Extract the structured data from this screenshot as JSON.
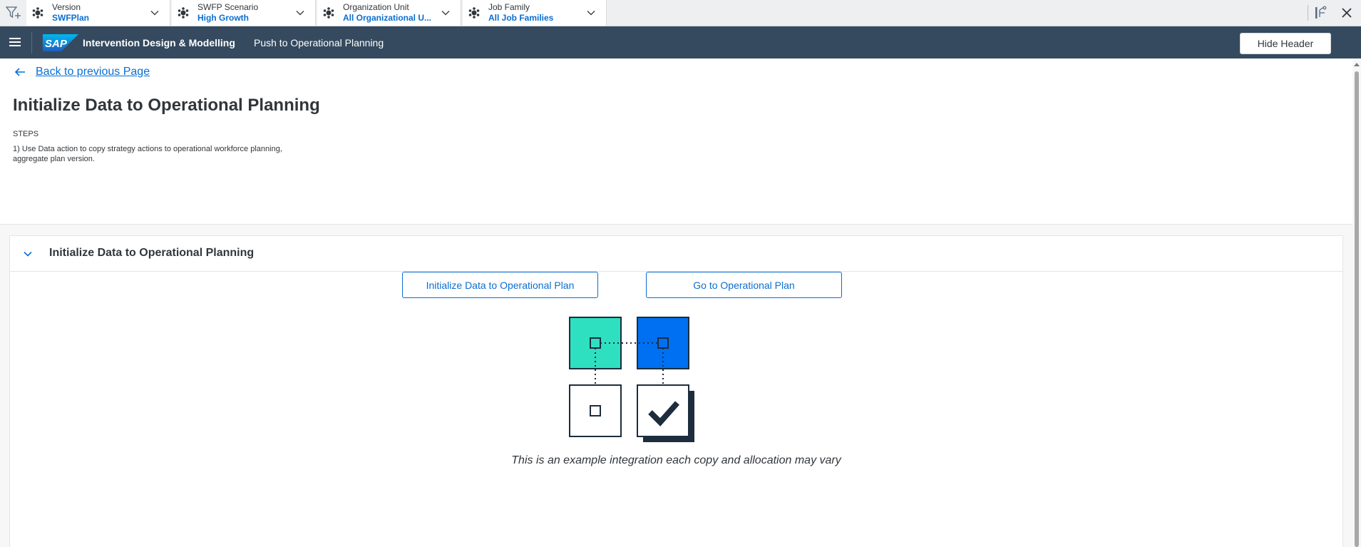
{
  "filter_bar": {
    "filters": [
      {
        "label": "Version",
        "value": "SWFPlan"
      },
      {
        "label": "SWFP Scenario",
        "value": "High Growth"
      },
      {
        "label": "Organization Unit",
        "value": "All Organizational U..."
      },
      {
        "label": "Job Family",
        "value": "All Job Families"
      }
    ]
  },
  "shell": {
    "logo_text": "SAP",
    "title": "Intervention Design & Modelling",
    "subtitle": "Push to Operational Planning",
    "hide_header_label": "Hide Header"
  },
  "header": {
    "back_label": "Back to previous Page",
    "title": "Initialize Data to Operational Planning",
    "steps_label": "STEPS",
    "steps_text": "1) Use Data action to copy strategy actions to operational workforce planning, aggregate plan version."
  },
  "panel": {
    "title": "Initialize Data to Operational Planning",
    "button_initialize": "Initialize Data to Operational Plan",
    "button_goto": "Go to Operational Plan",
    "caption": "This is an example integration each copy and allocation may vary"
  },
  "colors": {
    "shell_bg": "#354a5f",
    "accent": "#0a6ed1",
    "tile_teal": "#2ee0c0",
    "tile_blue": "#0070f2",
    "ink": "#1d2d3e"
  }
}
